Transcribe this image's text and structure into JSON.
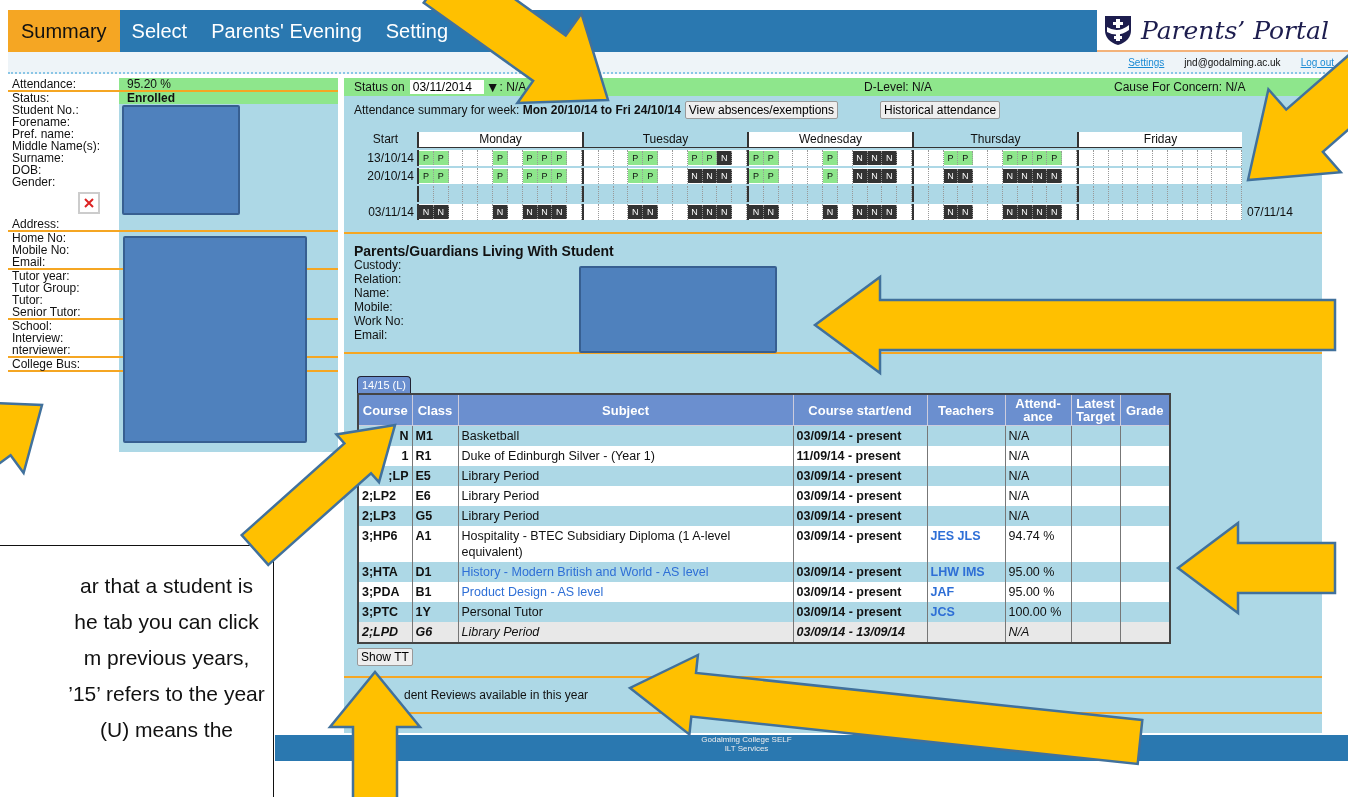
{
  "nav": {
    "tabs": [
      {
        "label": "Summary",
        "selected": true
      },
      {
        "label": "Select",
        "selected": false
      },
      {
        "label": "Parents' Evening",
        "selected": false
      },
      {
        "label": "Setting",
        "selected": false
      }
    ],
    "logo_text": "Parents’ Portal"
  },
  "user_bar": {
    "settings_link": "Settings",
    "email": "jnd@godalming.ac.uk",
    "logout_link": "Log out"
  },
  "student_panel": {
    "sections": [
      [
        {
          "label": "Attendance:",
          "value": "95.20 %",
          "highlighted": true
        }
      ],
      [
        {
          "label": "Status:",
          "value": "Enrolled",
          "highlighted": true
        },
        {
          "label": "Student No.:"
        },
        {
          "label": "Forename:"
        },
        {
          "label": "Pref. name:"
        },
        {
          "label": "Middle Name(s):"
        },
        {
          "label": "Surname:"
        },
        {
          "label": "DOB:"
        },
        {
          "label": "Gender:"
        },
        {
          "kind": "photo"
        },
        {
          "label": "Address:"
        }
      ],
      [
        {
          "label": "Home No:"
        },
        {
          "label": "Mobile No:"
        },
        {
          "label": "Email:"
        }
      ],
      [
        {
          "label": "Tutor year:"
        },
        {
          "label": "Tutor Group:"
        },
        {
          "label": "Tutor:"
        },
        {
          "label": "Senior Tutor:"
        }
      ],
      [
        {
          "label": "School:"
        },
        {
          "label": "Interview:"
        },
        {
          "label": "nterviewer:"
        }
      ],
      [
        {
          "label": "College Bus:"
        }
      ]
    ]
  },
  "status": {
    "label": "Status on",
    "date": "03/11/2014",
    "dropdown": "▼",
    "value": ": N/A",
    "d_level": "D-Level: N/A",
    "concern": "Cause For Concern: N/A"
  },
  "attendance": {
    "summary": "Attendance summary for week: **Mon 20/10/14 to Fri 24/10/14**",
    "buttons": [
      "View absences/exemptions",
      "Historical attendance"
    ],
    "start_header": "Start",
    "days": [
      "Monday",
      "Tuesday",
      "Wednesday",
      "Thursday",
      "Friday"
    ],
    "weeks": [
      {
        "start": "13/10/14",
        "kind": "week",
        "cells": [
          [
            "P",
            "P",
            null,
            null,
            null,
            "P",
            null,
            "P",
            "P",
            "P",
            null
          ],
          [
            null,
            null,
            null,
            "P",
            "P",
            null,
            null,
            "P",
            "P",
            "N",
            null
          ],
          [
            "P",
            "P",
            null,
            null,
            null,
            "P",
            null,
            "N",
            "N",
            "N",
            null
          ],
          [
            null,
            null,
            "P",
            "P",
            null,
            null,
            "P",
            "P",
            "P",
            "P",
            null
          ],
          [
            null,
            null,
            null,
            null,
            null,
            null,
            null,
            null,
            null,
            null,
            null
          ]
        ]
      },
      {
        "start": "20/10/14",
        "kind": "week",
        "cells": [
          [
            "P",
            "P",
            null,
            null,
            null,
            "P",
            null,
            "P",
            "P",
            "P",
            null
          ],
          [
            null,
            null,
            null,
            "P",
            "P",
            null,
            null,
            "N",
            "N",
            "N",
            null
          ],
          [
            "P",
            "P",
            null,
            null,
            null,
            "P",
            null,
            "N",
            "N",
            "N",
            null
          ],
          [
            null,
            null,
            "N",
            "N",
            null,
            null,
            "N",
            "N",
            "N",
            "N",
            null
          ],
          [
            null,
            null,
            null,
            null,
            null,
            null,
            null,
            null,
            null,
            null,
            null
          ]
        ]
      },
      {
        "kind": "spacer",
        "cells": [
          [
            null,
            null,
            null,
            null,
            null,
            null,
            null,
            null,
            null,
            null,
            null
          ],
          [
            null,
            null,
            null,
            null,
            null,
            null,
            null,
            null,
            null,
            null,
            null
          ],
          [
            null,
            null,
            null,
            null,
            null,
            null,
            null,
            null,
            null,
            null,
            null
          ],
          [
            null,
            null,
            null,
            null,
            null,
            null,
            null,
            null,
            null,
            null,
            null
          ],
          [
            null,
            null,
            null,
            null,
            null,
            null,
            null,
            null,
            null,
            null,
            null
          ]
        ]
      },
      {
        "start": "03/11/14",
        "end": "07/11/14",
        "kind": "week",
        "cells": [
          [
            "N",
            "N",
            null,
            null,
            null,
            "N",
            null,
            "N",
            "N",
            "N",
            null
          ],
          [
            null,
            null,
            null,
            "N",
            "N",
            null,
            null,
            "N",
            "N",
            "N",
            null
          ],
          [
            "N",
            "N",
            null,
            null,
            null,
            "N",
            null,
            "N",
            "N",
            "N",
            null
          ],
          [
            null,
            null,
            "N",
            "N",
            null,
            null,
            "N",
            "N",
            "N",
            "N",
            null
          ],
          [
            null,
            null,
            null,
            null,
            null,
            null,
            null,
            null,
            null,
            null,
            null
          ]
        ]
      }
    ]
  },
  "guardians": {
    "title": "Parents/Guardians Living With Student",
    "labels": [
      "Custody:",
      "Relation:",
      "Name:",
      "Mobile:",
      "Work No:",
      "Email:"
    ]
  },
  "courses": {
    "tabs": [
      {
        "label": "14/15 (L)",
        "selected": true
      }
    ],
    "columns": [
      "Course",
      "Class",
      "Subject",
      "Course start/end",
      "Teachers",
      "Attend-ance",
      "Latest Target",
      "Grade"
    ],
    "rows": [
      {
        "course": "N",
        "class": "M1",
        "subject": "Basketball",
        "dates": "03/09/14 - present",
        "attendance": "N/A",
        "linked": false,
        "ended": false
      },
      {
        "course": "1",
        "class": "R1",
        "subject": "Duke of Edinburgh Silver - (Year 1)",
        "dates": "11/09/14 - present",
        "attendance": "N/A",
        "linked": false,
        "ended": false
      },
      {
        "course": ";LP",
        "class": "E5",
        "subject": "Library Period",
        "dates": "03/09/14 - present",
        "attendance": "N/A",
        "linked": false,
        "ended": false
      },
      {
        "course": "2;LP2",
        "class": "E6",
        "subject": "Library Period",
        "dates": "03/09/14 - present",
        "attendance": "N/A",
        "linked": false,
        "ended": false
      },
      {
        "course": "2;LP3",
        "class": "G5",
        "subject": "Library Period",
        "dates": "03/09/14 - present",
        "attendance": "N/A",
        "linked": false,
        "ended": false
      },
      {
        "course": "3;HP6",
        "class": "A1",
        "subject": "Hospitality - BTEC Subsidiary Diploma (1 A-level equivalent)",
        "dates": "03/09/14 - present",
        "teachers": "JES JLS",
        "attendance": "94.74 %",
        "linked": false,
        "ended": false
      },
      {
        "course": "3;HTA",
        "class": "D1",
        "subject": "History - Modern British and World - AS level",
        "dates": "03/09/14 - present",
        "teachers": "LHW IMS",
        "attendance": "95.00 %",
        "linked": true,
        "ended": false
      },
      {
        "course": "3;PDA",
        "class": "B1",
        "subject": "Product Design - AS level",
        "dates": "03/09/14 - present",
        "teachers": "JAF",
        "attendance": "95.00 %",
        "linked": true,
        "ended": false
      },
      {
        "course": "3;PTC",
        "class": "1Y",
        "subject": "Personal Tutor",
        "dates": "03/09/14 - present",
        "teachers": "JCS",
        "attendance": "100.00 %",
        "linked": false,
        "ended": false
      },
      {
        "course": "2;LPD",
        "class": "G6",
        "subject": "Library Period",
        "dates": "03/09/14 - 13/09/14",
        "attendance": "N/A",
        "linked": false,
        "ended": true
      }
    ],
    "show_button": "Show TT"
  },
  "reviews": {
    "text": "dent Reviews available in this year"
  },
  "footer": {
    "lines": [
      "Godalming College SELF",
      "ILT Services"
    ]
  },
  "note": {
    "lines": [
      "ar that a student is",
      "he tab you can click",
      "m previous years,",
      "’15’ refers to the year",
      "(U) means the"
    ]
  }
}
